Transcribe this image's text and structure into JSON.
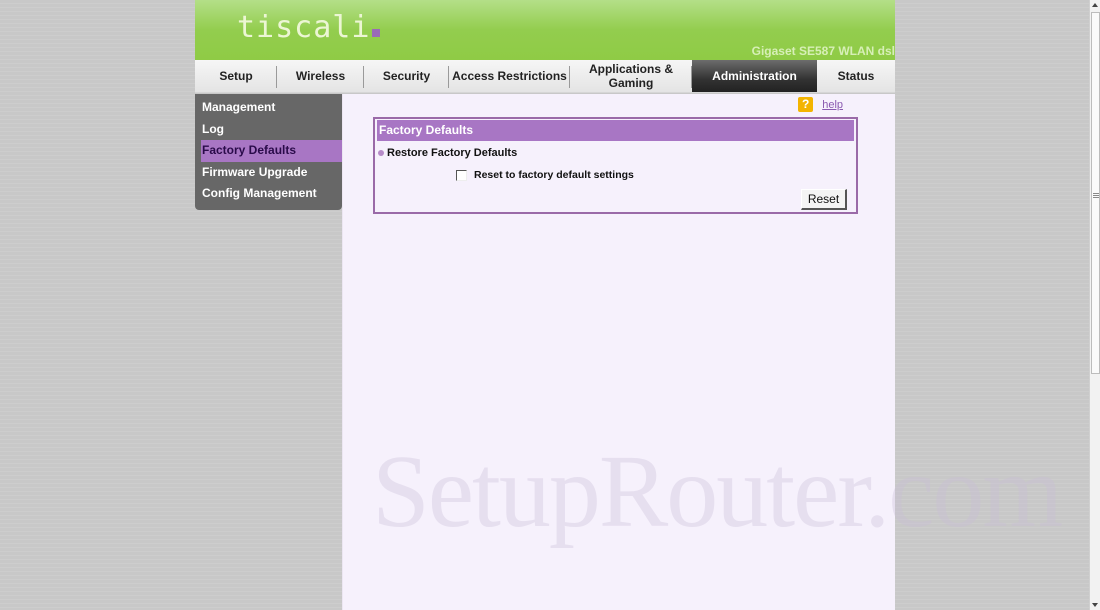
{
  "header": {
    "logo_text": "tiscali",
    "model_name": "Gigaset SE587 WLAN dsl"
  },
  "tabs": [
    {
      "label": "Setup",
      "active": false
    },
    {
      "label": "Wireless",
      "active": false
    },
    {
      "label": "Security",
      "active": false
    },
    {
      "label": "Access Restrictions",
      "active": false
    },
    {
      "label": "Applications & Gaming",
      "active": false
    },
    {
      "label": "Administration",
      "active": true
    },
    {
      "label": "Status",
      "active": false
    }
  ],
  "sidebar": {
    "items": [
      {
        "label": "Management",
        "active": false
      },
      {
        "label": "Log",
        "active": false
      },
      {
        "label": "Factory Defaults",
        "active": true
      },
      {
        "label": "Firmware Upgrade",
        "active": false
      },
      {
        "label": "Config Management",
        "active": false
      }
    ]
  },
  "help": {
    "icon": "question-icon",
    "icon_glyph": "?",
    "link_label": "help"
  },
  "panel": {
    "title": "Factory Defaults",
    "section_label": "Restore Factory Defaults",
    "checkbox_label": "Reset to factory default settings",
    "checkbox_checked": false,
    "reset_button_label": "Reset"
  },
  "watermark": "SetupRouter.com",
  "colors": {
    "brand_green": "#8fcb45",
    "accent_purple": "#a876c4",
    "active_tab": "#333333",
    "content_bg": "#f6f1fc"
  }
}
